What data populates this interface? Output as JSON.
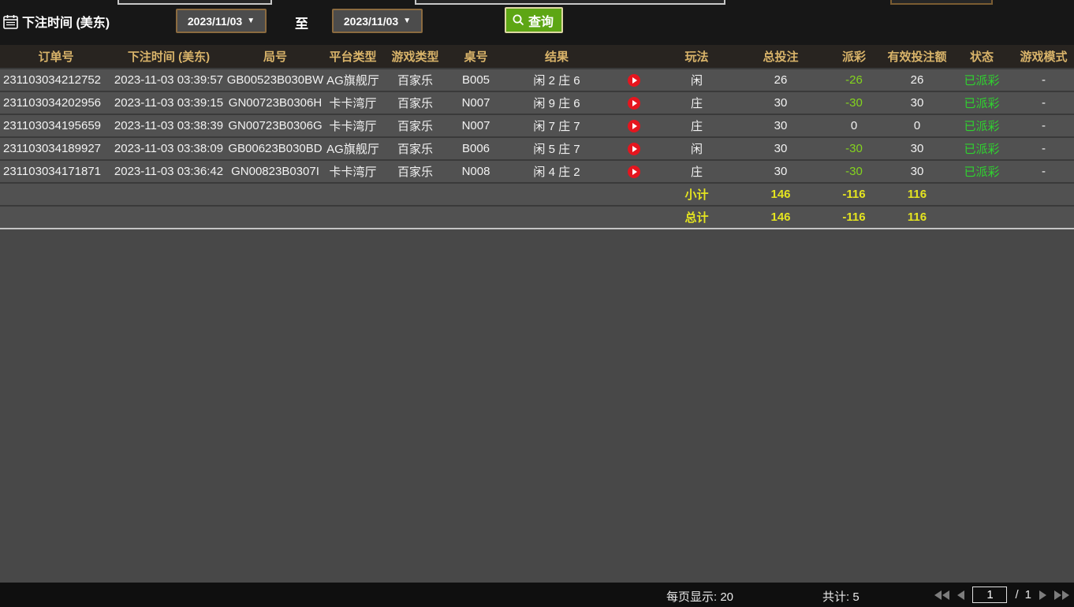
{
  "filters": {
    "field_label": "下注时间 (美东)",
    "date_from": "2023/11/03",
    "date_to": "2023/11/03",
    "to_label": "至",
    "query_label": "查询",
    "dropdown_arrow": "▼"
  },
  "table": {
    "columns": {
      "order_id": "订单号",
      "bet_time": "下注时间 (美东)",
      "round_id": "局号",
      "platform": "平台类型",
      "game_type": "游戏类型",
      "table_id": "桌号",
      "result": "结果",
      "play": "玩法",
      "total_bet": "总投注",
      "payout": "派彩",
      "valid_bet": "有效投注额",
      "status": "状态",
      "game_mode": "游戏模式"
    },
    "rows": [
      {
        "order_id": "231103034212752",
        "bet_time": "2023-11-03 03:39:57",
        "round_id": "GB00523B030BW",
        "platform": "AG旗舰厅",
        "game_type": "百家乐",
        "table_id": "B005",
        "result": "闲 2 庄 6",
        "play": "闲",
        "total_bet": "26",
        "payout": "-26",
        "valid_bet": "26",
        "status": "已派彩",
        "game_mode": "-"
      },
      {
        "order_id": "231103034202956",
        "bet_time": "2023-11-03 03:39:15",
        "round_id": "GN00723B0306H",
        "platform": "卡卡湾厅",
        "game_type": "百家乐",
        "table_id": "N007",
        "result": "闲 9 庄 6",
        "play": "庄",
        "total_bet": "30",
        "payout": "-30",
        "valid_bet": "30",
        "status": "已派彩",
        "game_mode": "-"
      },
      {
        "order_id": "231103034195659",
        "bet_time": "2023-11-03 03:38:39",
        "round_id": "GN00723B0306G",
        "platform": "卡卡湾厅",
        "game_type": "百家乐",
        "table_id": "N007",
        "result": "闲 7 庄 7",
        "play": "庄",
        "total_bet": "30",
        "payout": "0",
        "valid_bet": "0",
        "status": "已派彩",
        "game_mode": "-"
      },
      {
        "order_id": "231103034189927",
        "bet_time": "2023-11-03 03:38:09",
        "round_id": "GB00623B030BD",
        "platform": "AG旗舰厅",
        "game_type": "百家乐",
        "table_id": "B006",
        "result": "闲 5 庄 7",
        "play": "闲",
        "total_bet": "30",
        "payout": "-30",
        "valid_bet": "30",
        "status": "已派彩",
        "game_mode": "-"
      },
      {
        "order_id": "231103034171871",
        "bet_time": "2023-11-03 03:36:42",
        "round_id": "GN00823B0307I",
        "platform": "卡卡湾厅",
        "game_type": "百家乐",
        "table_id": "N008",
        "result": "闲 4 庄 2",
        "play": "庄",
        "total_bet": "30",
        "payout": "-30",
        "valid_bet": "30",
        "status": "已派彩",
        "game_mode": "-"
      }
    ],
    "subtotal": {
      "label": "小计",
      "total_bet": "146",
      "payout": "-116",
      "valid_bet": "116"
    },
    "total": {
      "label": "总计",
      "total_bet": "146",
      "payout": "-116",
      "valid_bet": "116"
    }
  },
  "footer": {
    "page_size_label": "每页显示:",
    "page_size_value": "20",
    "total_count_label": "共计:",
    "total_count_value": "5",
    "page_value": "1",
    "page_separator": "/",
    "page_total": "1"
  },
  "colors": {
    "header_text": "#d9b46a",
    "payout_negative_green": "#84d41e",
    "status_green": "#2fd32f",
    "totals_yellow": "#e4e420",
    "query_button_green": "#5da614",
    "play_icon_red": "#e5151e",
    "date_border_brown": "#8b6b40"
  }
}
